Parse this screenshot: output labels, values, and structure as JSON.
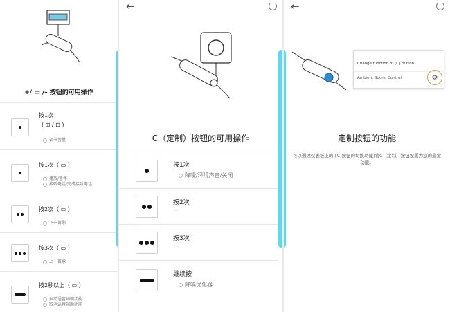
{
  "panel1": {
    "title": "+/ ▭ /– 按钮的可用操作",
    "rows": [
      {
        "action": "按1次",
        "hint": "( ⊞ / ⊟ )",
        "subs": [
          "调节音量"
        ]
      },
      {
        "action": "按1次（ ▭ ）",
        "subs": [
          "播放/暂停",
          "接听电话/完成接听电话"
        ]
      },
      {
        "action": "按2次（ ▭ ）",
        "subs": [
          "下一首歌"
        ]
      },
      {
        "action": "按3次（ ▭ ）",
        "subs": [
          "上一首歌"
        ]
      },
      {
        "action": "按2秒以上（ ▭ ）",
        "subs": [
          "启动语音辅助功能",
          "取消语音辅助功能"
        ]
      }
    ]
  },
  "panel2": {
    "title": "C（定制）按钮的可用操作",
    "rows": [
      {
        "action": "按1次",
        "desc": "降噪/环境声音/关闭"
      },
      {
        "action": "按2次",
        "desc": "—"
      },
      {
        "action": "按3次",
        "desc": "—"
      },
      {
        "action": "继续按",
        "desc": "降噪优化器"
      }
    ]
  },
  "panel3": {
    "card_title": "Change function of [C] button",
    "card_option": "Ambient Sound Control",
    "title": "定制按钮的功能",
    "body": "可以通过仪表板上的[[C]按钮的切换功能]将C（定制）按钮设置为您的最爱功能。"
  },
  "icons": {
    "back": "back-arrow-icon",
    "refresh": "refresh-icon",
    "gear": "gear-icon"
  },
  "colors": {
    "accent": "#5fd8ea",
    "highlight": "#2b8bd6",
    "gold": "#c9a24a"
  }
}
